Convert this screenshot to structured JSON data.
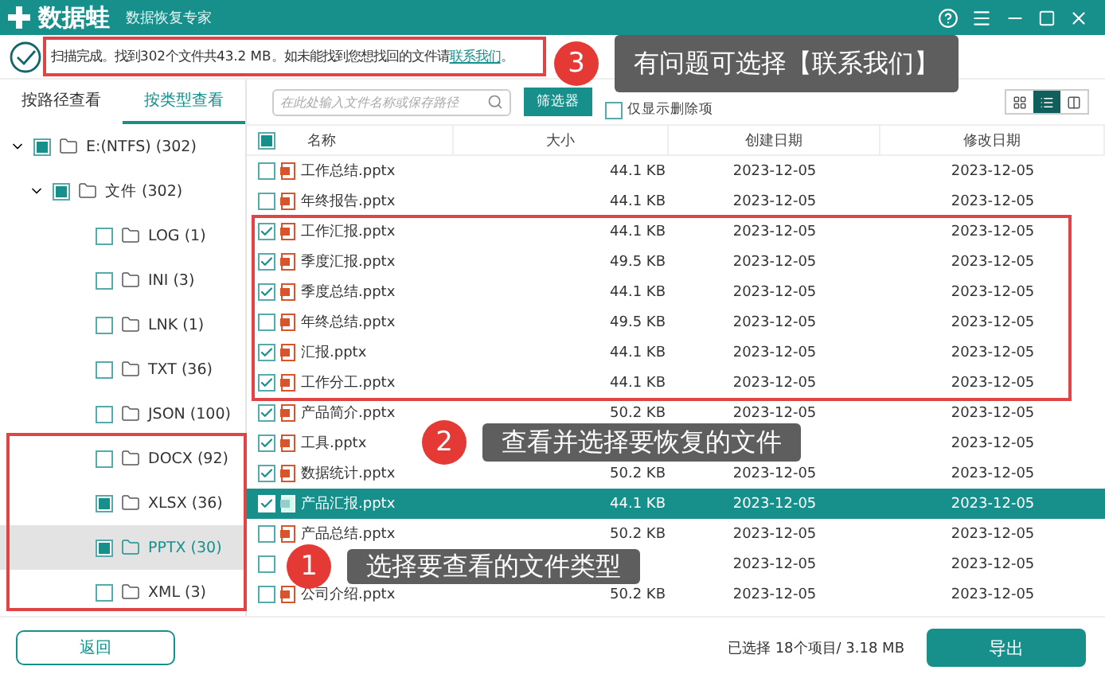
{
  "app": {
    "logo_text": "数据蛙",
    "subtitle": "数据恢复专家"
  },
  "scan_status": {
    "text": "扫描完成。找到302个文件共43.2 MB。如未能找到您想找回的文件请",
    "link": "联系我们",
    "end": "。"
  },
  "view_tabs": [
    {
      "label": "按路径查看",
      "selected": false
    },
    {
      "label": "按类型查看",
      "selected": true
    }
  ],
  "search": {
    "placeholder": "在此处输入文件名称或保存路径"
  },
  "filter_button": "筛选器",
  "deleted_only": {
    "label": "仅显示删除项",
    "checked": false
  },
  "view_modes": [
    {
      "kind": "grid",
      "selected": false
    },
    {
      "kind": "list",
      "selected": true
    },
    {
      "kind": "detail",
      "selected": false
    }
  ],
  "tree": [
    {
      "label": "E:(NTFS) (302)",
      "checked": true,
      "expanded": true,
      "selected": false,
      "children": [
        {
          "label": "文件 (302)",
          "checked": true,
          "expanded": true,
          "selected": false,
          "children": [
            {
              "label": "LOG (1)",
              "checked": false,
              "selected": false
            },
            {
              "label": "INI (3)",
              "checked": false,
              "selected": false
            },
            {
              "label": "LNK (1)",
              "checked": false,
              "selected": false
            },
            {
              "label": "TXT (36)",
              "checked": false,
              "selected": false
            },
            {
              "label": "JSON (100)",
              "checked": false,
              "selected": false
            },
            {
              "label": "DOCX (92)",
              "checked": false,
              "selected": false
            },
            {
              "label": "XLSX (36)",
              "checked": true,
              "selected": false
            },
            {
              "label": "PPTX (30)",
              "checked": true,
              "selected": true
            },
            {
              "label": "XML (3)",
              "checked": false,
              "selected": false
            }
          ]
        }
      ]
    }
  ],
  "table": {
    "select_all": {
      "checked": true
    },
    "columns": [
      "名称",
      "大小",
      "创建日期",
      "修改日期"
    ],
    "rows": [
      {
        "name": "工作总结.pptx",
        "size": "44.1 KB",
        "created": "2023-12-05",
        "modified": "2023-12-05",
        "checked": false,
        "selected": false
      },
      {
        "name": "年终报告.pptx",
        "size": "44.1 KB",
        "created": "2023-12-05",
        "modified": "2023-12-05",
        "checked": false,
        "selected": false
      },
      {
        "name": "工作汇报.pptx",
        "size": "44.1 KB",
        "created": "2023-12-05",
        "modified": "2023-12-05",
        "checked": true,
        "selected": false
      },
      {
        "name": "季度汇报.pptx",
        "size": "49.5 KB",
        "created": "2023-12-05",
        "modified": "2023-12-05",
        "checked": true,
        "selected": false
      },
      {
        "name": "季度总结.pptx",
        "size": "44.1 KB",
        "created": "2023-12-05",
        "modified": "2023-12-05",
        "checked": true,
        "selected": false
      },
      {
        "name": "年终总结.pptx",
        "size": "49.5 KB",
        "created": "2023-12-05",
        "modified": "2023-12-05",
        "checked": false,
        "selected": false
      },
      {
        "name": "汇报.pptx",
        "size": "44.1 KB",
        "created": "2023-12-05",
        "modified": "2023-12-05",
        "checked": true,
        "selected": false
      },
      {
        "name": "工作分工.pptx",
        "size": "44.1 KB",
        "created": "2023-12-05",
        "modified": "2023-12-05",
        "checked": true,
        "selected": false
      },
      {
        "name": "产品简介.pptx",
        "size": "50.2 KB",
        "created": "2023-12-05",
        "modified": "2023-12-05",
        "checked": true,
        "selected": false
      },
      {
        "name": "工具.pptx",
        "modified": "2023-12-05",
        "checked": true,
        "selected": false
      },
      {
        "name": "数据统计.pptx",
        "size": "50.2 KB",
        "created": "2023-12-05",
        "modified": "2023-12-05",
        "checked": true,
        "selected": false
      },
      {
        "name": "产品汇报.pptx",
        "size": "44.1 KB",
        "created": "2023-12-05",
        "modified": "2023-12-05",
        "checked": true,
        "selected": true
      },
      {
        "name": "产品总结.pptx",
        "size": "50.2 KB",
        "created": "2023-12-05",
        "modified": "2023-12-05",
        "checked": false,
        "selected": false
      },
      {
        "created": "2023-12-05",
        "modified": "2023-12-05",
        "checked": false,
        "selected": false
      },
      {
        "name": "公司介绍.pptx",
        "size": "50.2 KB",
        "created": "2023-12-05",
        "modified": "2023-12-05",
        "checked": false,
        "selected": false
      }
    ]
  },
  "footer": {
    "back_button": "返回",
    "selection_summary": "已选择 18个项目/ 3.18 MB",
    "export_button": "导出"
  },
  "callouts": [
    {
      "number": "3",
      "text": "有问题可选择【联系我们】"
    },
    {
      "number": "2",
      "text": "查看并选择要恢复的文件"
    },
    {
      "number": "1",
      "text": "选择要查看的文件类型"
    }
  ]
}
